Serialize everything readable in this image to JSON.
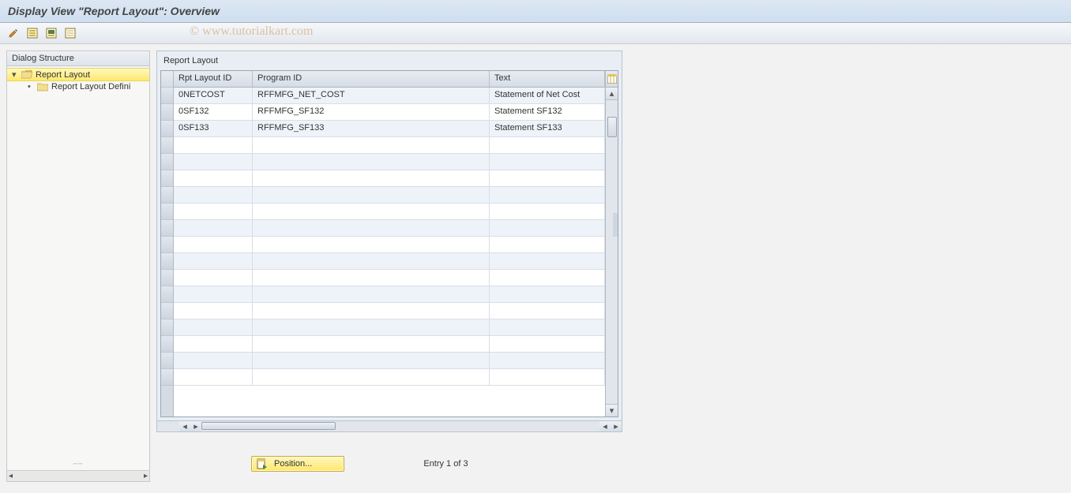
{
  "header": {
    "title": "Display View \"Report Layout\": Overview"
  },
  "watermark": "© www.tutorialkart.com",
  "tree": {
    "header": "Dialog Structure",
    "nodes": [
      {
        "label": "Report Layout",
        "level": 1,
        "open": true,
        "selected": true
      },
      {
        "label": "Report Layout Defini",
        "level": 2,
        "open": false,
        "selected": false
      }
    ]
  },
  "grid": {
    "title": "Report Layout",
    "columns": [
      "Rpt Layout ID",
      "Program ID",
      "Text"
    ],
    "rows": [
      {
        "id": "0NETCOST",
        "program": "RFFMFG_NET_COST",
        "text": "Statement of Net Cost"
      },
      {
        "id": "0SF132",
        "program": "RFFMFG_SF132",
        "text": "Statement SF132"
      },
      {
        "id": "0SF133",
        "program": "RFFMFG_SF133",
        "text": "Statement SF133"
      }
    ],
    "total_visible_rows": 18
  },
  "footer": {
    "position_label": "Position...",
    "entry_text": "Entry 1 of 3"
  },
  "icons": {
    "toolbar": [
      "change-icon",
      "select-all-icon",
      "select-block-icon",
      "deselect-all-icon"
    ]
  }
}
